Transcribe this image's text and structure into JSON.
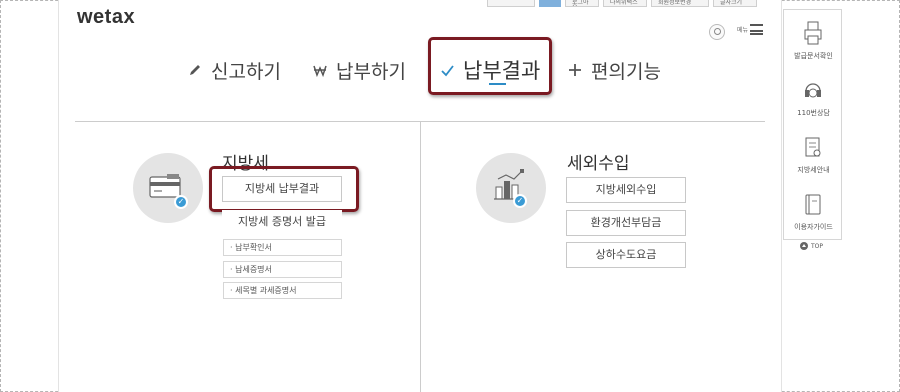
{
  "header": {
    "logo_text": "wetax",
    "util_links": [
      "",
      "",
      "로그아웃",
      "나의위택스",
      "회원정보변경",
      "글자크기"
    ],
    "menu_label": "메뉴"
  },
  "nav": {
    "items": [
      {
        "label": "신고하기",
        "icon": "pencil-icon"
      },
      {
        "label": "납부하기",
        "icon": "won-icon"
      },
      {
        "label": "납부결과",
        "icon": "check-icon",
        "active": true
      },
      {
        "label": "편의기능",
        "icon": "plus-icon"
      }
    ]
  },
  "left_section": {
    "title": "지방세",
    "buttons": [
      "지방세 납부결과",
      "지방세 증명서 발급"
    ],
    "sub_items": [
      "납부확인서",
      "납세증명서",
      "세목별 과세증명서"
    ]
  },
  "right_section": {
    "title": "세외수입",
    "buttons": [
      "지방세외수입",
      "환경개선부담금",
      "상하수도요금"
    ]
  },
  "sidebar": {
    "items": [
      "발급문서확인",
      "110번상담",
      "지방세안내",
      "이용자가이드"
    ],
    "top_label": "TOP"
  },
  "colors": {
    "accent": "#2d8cc6",
    "highlight_border": "#7a1a22",
    "badge": "#3a9bd5"
  }
}
